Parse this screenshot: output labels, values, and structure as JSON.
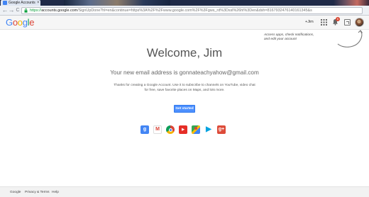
{
  "browser": {
    "tab_title": "Google Accounts",
    "tab_close": "×",
    "back_glyph": "←",
    "forward_glyph": "→",
    "reload_glyph": "C",
    "url_scheme": "https://",
    "url_host": "accounts.google.com",
    "url_rest": "/SignUpDone?hl=en&continue=https%3A%2F%2Fwww.google.com%2F%3Fgws_rd%3Dssl%26hl%3Den&dsh=8167932476140161345&s"
  },
  "header": {
    "logo_letters": [
      "G",
      "o",
      "o",
      "g",
      "l",
      "e"
    ],
    "logo_colors": [
      "#4285f4",
      "#db4437",
      "#f4b400",
      "#4285f4",
      "#0f9d58",
      "#db4437"
    ],
    "user_label": "+Jim",
    "notification_count": "6"
  },
  "callout": {
    "text": "Access apps, check notifications, and edit your account"
  },
  "main": {
    "welcome": "Welcome, Jim",
    "email_line": "Your new email address is gonnateachyahow@gmail.com",
    "description": "Thanks for creating a Google Account. Use it to subscribe to channels on YouTube, video chat for free, save favorite places on Maps, and lots more.",
    "get_started": "Get started"
  },
  "products": [
    {
      "name": "google-search",
      "glyph": "g",
      "color": "#4285f4"
    },
    {
      "name": "gmail",
      "glyph": "M",
      "color": "#db4437"
    },
    {
      "name": "chrome",
      "glyph": "",
      "color": "#f4b400"
    },
    {
      "name": "youtube",
      "glyph": "▶",
      "color": "#e52d27"
    },
    {
      "name": "maps",
      "glyph": "",
      "color": "#34a853"
    },
    {
      "name": "play",
      "glyph": "▶",
      "color": "#00a3e0"
    },
    {
      "name": "google-plus",
      "glyph": "g+",
      "color": "#dd4b39"
    }
  ],
  "footer": {
    "google": "Google",
    "privacy_terms": "Privacy & Terms",
    "help": "Help"
  }
}
